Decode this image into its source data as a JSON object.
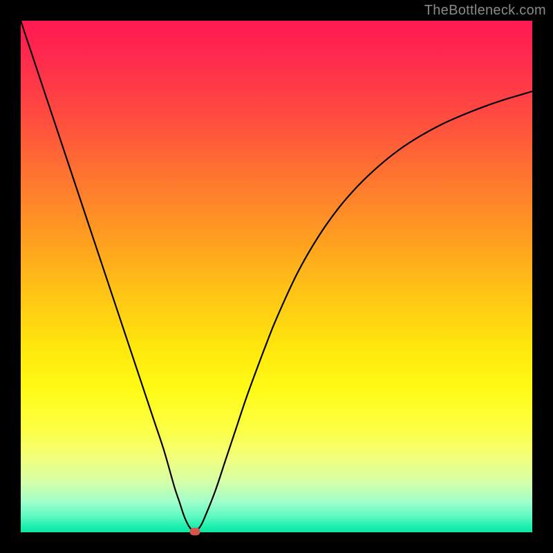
{
  "watermark": "TheBottleneck.com",
  "chart_data": {
    "type": "line",
    "title": "",
    "xlabel": "",
    "ylabel": "",
    "xlim": [
      0,
      100
    ],
    "ylim": [
      0,
      100
    ],
    "grid": false,
    "x": [
      0,
      2,
      4,
      6,
      8,
      10,
      12,
      14,
      16,
      18,
      20,
      22,
      24,
      26,
      28,
      30,
      31,
      32,
      33,
      34,
      35,
      36,
      38,
      40,
      42,
      44,
      46,
      48,
      50,
      54,
      58,
      62,
      66,
      70,
      74,
      78,
      82,
      86,
      90,
      94,
      98,
      100
    ],
    "y": [
      100,
      94,
      88,
      82,
      76,
      70,
      64,
      58,
      52,
      46,
      40,
      34,
      28,
      22,
      16,
      9,
      6,
      3,
      1,
      0.2,
      1,
      3,
      8,
      14,
      20,
      26,
      31.5,
      36.8,
      41.8,
      50.5,
      57.5,
      63.2,
      67.8,
      71.6,
      74.8,
      77.4,
      79.6,
      81.4,
      83,
      84.4,
      85.6,
      86.2
    ],
    "marker": {
      "x": 34,
      "y": 0.2,
      "color": "#d6554f"
    }
  }
}
